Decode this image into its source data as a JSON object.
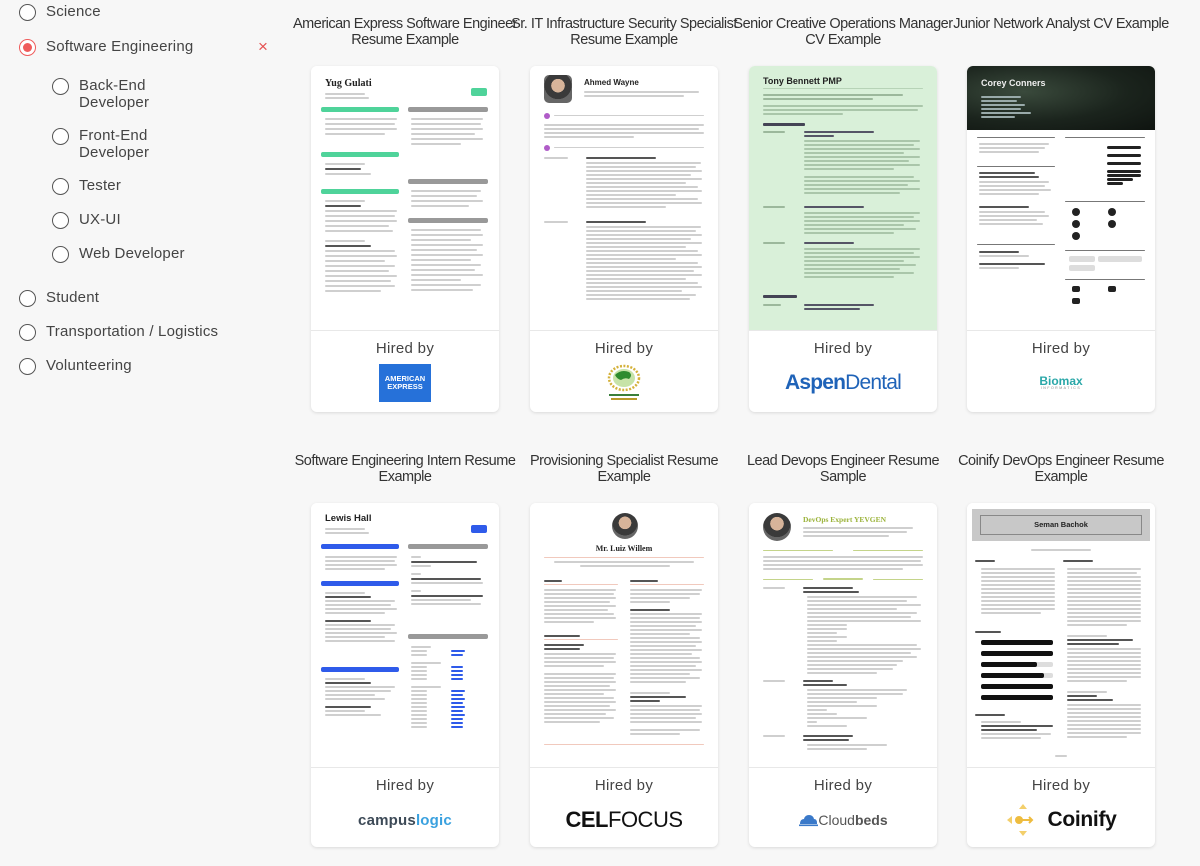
{
  "filters": {
    "categories": [
      {
        "label": "Science",
        "selected": false
      },
      {
        "label": "Software Engineering",
        "selected": true
      },
      {
        "label": "Student",
        "selected": false
      },
      {
        "label": "Transportation / Logistics",
        "selected": false
      },
      {
        "label": "Volunteering",
        "selected": false
      }
    ],
    "subcategories": [
      {
        "label": "Back-End Developer",
        "selected": false
      },
      {
        "label": "Front-End Developer",
        "selected": false
      },
      {
        "label": "Tester",
        "selected": false
      },
      {
        "label": "UX-UI",
        "selected": false
      },
      {
        "label": "Web Developer",
        "selected": false
      }
    ],
    "clear_icon": "×",
    "accent_color": "#ef5b5b"
  },
  "hired_by_label": "Hired by",
  "cards": [
    {
      "title": "American Express Software Engineer Resume Example",
      "resume_name": "Yug Gulati",
      "company": "American Express",
      "logo_text": [
        "AMERICAN",
        "EXPRESS"
      ],
      "theme_color": "#4fd39a"
    },
    {
      "title": "Sr. IT Infrastructure Security Specialist Resume Example",
      "resume_name": "Ahmed Wayne",
      "company": "Arab Monetary Fund",
      "logo_text": [
        "ARAB MONETARY FUND"
      ],
      "theme_color": "#b05cc8"
    },
    {
      "title": "Senior Creative Operations Manager CV Example",
      "resume_name": "Tony Bennett PMP",
      "company": "Aspen Dental",
      "logo_text": [
        "Aspen",
        "Dental"
      ],
      "theme_color": "#d9f0d9"
    },
    {
      "title": "Junior Network Analyst CV Example",
      "resume_name": "Corey Conners",
      "company": "Biomax Informatics",
      "logo_text": [
        "Biomax",
        "INFORMATICS"
      ],
      "theme_color": "#1f2a22"
    },
    {
      "title": "Software Engineering Intern Resume Example",
      "resume_name": "Lewis Hall",
      "company": "campuslogic",
      "logo_text": [
        "campus",
        "logic"
      ],
      "theme_color": "#2f5bea"
    },
    {
      "title": "Provisioning Specialist Resume Example",
      "resume_name": "Mr. Luiz Willem",
      "company": "Celfocus",
      "logo_text": [
        "CEL",
        "FOCUS"
      ],
      "theme_color": "#f1c9bd"
    },
    {
      "title": "Lead Devops Engineer Resume Sample",
      "resume_name": "DevOps Expert YEVGEN",
      "company": "Cloudbeds",
      "logo_text": [
        "Cloud",
        "beds"
      ],
      "theme_color": "#9bb33a"
    },
    {
      "title": "Coinify DevOps Engineer Resume Example",
      "resume_name": "Seman Bachok",
      "company": "Coinify",
      "logo_text": [
        "Coinify"
      ],
      "theme_color": "#c8c8c8"
    }
  ],
  "resume_sections": {
    "yug": [
      "Profile",
      "Work experience",
      "Education",
      "Skills",
      "Academic Projects"
    ],
    "ahmed": [
      "Profile",
      "Work experience"
    ],
    "tony": [
      "Work experience",
      "Certificates"
    ],
    "corey": [
      "Profile",
      "Skills",
      "Experience",
      "Languages",
      "Education",
      "Strengths",
      "Hobbies"
    ],
    "lewis": [
      "Profile",
      "Awards/Recognition",
      "Work Experience",
      "Skills",
      "Education"
    ],
    "luiz": [
      "Profile",
      "Work experience"
    ],
    "yevgen": [
      "Profile",
      "Professional Background"
    ],
    "seman": [
      "Profile",
      "Work experience",
      "Strengths"
    ]
  }
}
